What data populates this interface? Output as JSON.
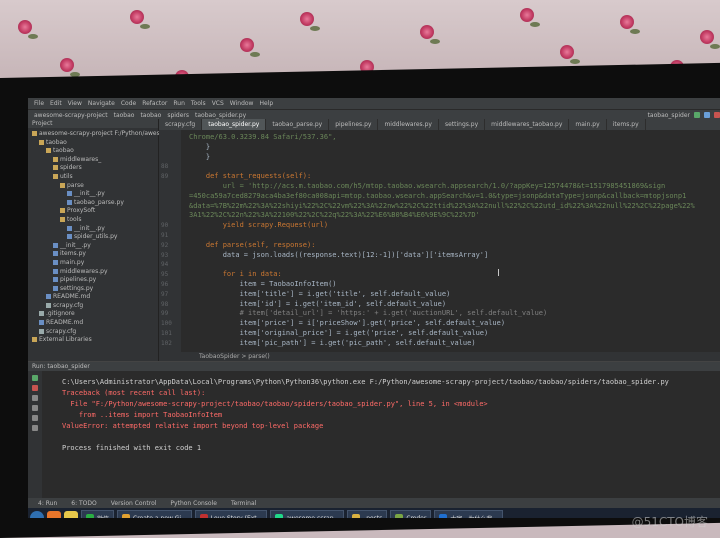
{
  "menu": [
    "File",
    "Edit",
    "View",
    "Navigate",
    "Code",
    "Refactor",
    "Run",
    "Tools",
    "VCS",
    "Window",
    "Help"
  ],
  "navbar": {
    "crumbs": [
      "awesome-scrapy-project",
      "taobao",
      "taobao",
      "spiders",
      "taobao_spider.py"
    ],
    "run_config": "taobao_spider"
  },
  "project": {
    "title": "Project",
    "tree": [
      {
        "label": "awesome-scrapy-project  F:/Python/awesom",
        "kind": "folder",
        "depth": 0
      },
      {
        "label": "taobao",
        "kind": "folder",
        "depth": 1
      },
      {
        "label": "taobao",
        "kind": "folder",
        "depth": 2
      },
      {
        "label": "middlewares_",
        "kind": "folder",
        "depth": 3
      },
      {
        "label": "spiders",
        "kind": "folder",
        "depth": 3
      },
      {
        "label": "utils",
        "kind": "folder",
        "depth": 3
      },
      {
        "label": "parse",
        "kind": "folder",
        "depth": 4
      },
      {
        "label": "__init__.py",
        "kind": "file",
        "depth": 5
      },
      {
        "label": "taobao_parse.py",
        "kind": "file",
        "depth": 5
      },
      {
        "label": "ProxySoft",
        "kind": "folder",
        "depth": 4
      },
      {
        "label": "tools",
        "kind": "folder",
        "depth": 4
      },
      {
        "label": "__init__.py",
        "kind": "file",
        "depth": 5
      },
      {
        "label": "spider_utils.py",
        "kind": "file",
        "depth": 5
      },
      {
        "label": "__init__.py",
        "kind": "file",
        "depth": 3
      },
      {
        "label": "items.py",
        "kind": "file",
        "depth": 3
      },
      {
        "label": "main.py",
        "kind": "file",
        "depth": 3
      },
      {
        "label": "middlewares.py",
        "kind": "file",
        "depth": 3
      },
      {
        "label": "pipelines.py",
        "kind": "file",
        "depth": 3
      },
      {
        "label": "settings.py",
        "kind": "file",
        "depth": 3
      },
      {
        "label": "README.md",
        "kind": "file",
        "depth": 2
      },
      {
        "label": "scrapy.cfg",
        "kind": "cfg",
        "depth": 2
      },
      {
        "label": ".gitignore",
        "kind": "cfg",
        "depth": 1
      },
      {
        "label": "README.md",
        "kind": "file",
        "depth": 1
      },
      {
        "label": "scrapy.cfg",
        "kind": "cfg",
        "depth": 1
      },
      {
        "label": "External Libraries",
        "kind": "folder",
        "depth": 0
      }
    ]
  },
  "tabs": [
    "scrapy.cfg",
    "taobao_spider.py",
    "taobao_parse.py",
    "pipelines.py",
    "middlewares.py",
    "settings.py",
    "middlewares_taobao.py",
    "main.py",
    "items.py"
  ],
  "active_tab": 1,
  "editor": {
    "lines": [
      {
        "n": "",
        "t": "Chrome/63.0.3239.84 Safari/537.36\","
      },
      {
        "n": "",
        "t": "    }"
      },
      {
        "n": "",
        "t": "    }"
      },
      {
        "n": "88",
        "t": ""
      },
      {
        "n": "89",
        "t": "    def start_requests(self):"
      },
      {
        "n": "",
        "t": "        url = 'http://acs.m.taobao.com/h5/mtop.taobao.wsearch.appsearch/1.0/?appKey=12574478&t=1517985451869&sign"
      },
      {
        "n": "",
        "t": "=450ca59a7ced8279aca4ba3ef80ca008api=mtop.taobao.wsearch.appSearch&v=1.0&type=jsonp&dataType=jsonp&callback=mtopjsonp1"
      },
      {
        "n": "",
        "t": "&data=%7B%22m%22%3A%22shiyi%22%2C%22vm%22%3A%22nw%22%2C%22ttid%22%3A%22null%22%2C%22utd_id%22%3A%22null%22%2C%22page%22%"
      },
      {
        "n": "",
        "t": "3A1%22%2C%22n%22%3A%22100%22%2C%22q%22%3A%22%E6%B0%B4%E6%9E%9C%22%7D'"
      },
      {
        "n": "90",
        "t": "        yield scrapy.Request(url)"
      },
      {
        "n": "91",
        "t": ""
      },
      {
        "n": "92",
        "t": "    def parse(self, response):"
      },
      {
        "n": "93",
        "t": "        data = json.loads((response.text)[12:-1])['data']['itemsArray']"
      },
      {
        "n": "94",
        "t": ""
      },
      {
        "n": "95",
        "t": "        for i in data:"
      },
      {
        "n": "96",
        "t": "            item = TaobaoInfoItem()"
      },
      {
        "n": "97",
        "t": "            item['title'] = i.get('title', self.default_value)"
      },
      {
        "n": "98",
        "t": "            item['id'] = i.get('item_id', self.default_value)"
      },
      {
        "n": "99",
        "t": "            # item['detail_url'] = 'https:' + i.get('auctionURL', self.default_value)"
      },
      {
        "n": "100",
        "t": "            item['price'] = i['priceShow'].get('price', self.default_value)"
      },
      {
        "n": "101",
        "t": "            item['original_price'] = i.get('price', self.default_value)"
      },
      {
        "n": "102",
        "t": "            item['pic_path'] = i.get('pic_path', self.default_value)"
      }
    ],
    "breadcrumb": "TaobaoSpider  >  parse()"
  },
  "console": {
    "header": "Run:  taobao_spider",
    "lines": [
      {
        "t": "C:\\Users\\Administrator\\AppData\\Local\\Programs\\Python\\Python36\\python.exe F:/Python/awesome-scrapy-project/taobao/taobao/spiders/taobao_spider.py",
        "c": "#d0d0d0"
      },
      {
        "t": "Traceback (most recent call last):",
        "c": "#ff6b68"
      },
      {
        "t": "  File \"F:/Python/awesome-scrapy-project/taobao/taobao/spiders/taobao_spider.py\", line 5, in <module>",
        "c": "#ff6b68"
      },
      {
        "t": "    from ..items import TaobaoInfoItem",
        "c": "#ff6b68"
      },
      {
        "t": "ValueError: attempted relative import beyond top-level package",
        "c": "#ff6b68"
      },
      {
        "t": "",
        "c": "#d0d0d0"
      },
      {
        "t": "Process finished with exit code 1",
        "c": "#d0d0d0"
      }
    ]
  },
  "bottom_tabs": [
    "4: Run",
    "6: TODO",
    "Version Control",
    "Python Console",
    "Terminal"
  ],
  "taskbar": {
    "items": [
      {
        "label": "微信",
        "color": "#2aae43"
      },
      {
        "label": "Create a new Gi...",
        "color": "#e0a030"
      },
      {
        "label": "Love Story (Ext...",
        "color": "#c03030"
      },
      {
        "label": "awesome-scrap...",
        "color": "#21d789"
      },
      {
        "label": "_posts",
        "color": "#d8b040"
      },
      {
        "label": "Cmder",
        "color": "#7aa545"
      },
      {
        "label": "大咖，为什么我...",
        "color": "#1f6fd0"
      }
    ]
  },
  "watermark": "@51CTO博客",
  "colors": {
    "keyword": "#cc7832",
    "string": "#6a8759",
    "func": "#ffc66d",
    "comment": "#808080",
    "error": "#ff6b68"
  }
}
